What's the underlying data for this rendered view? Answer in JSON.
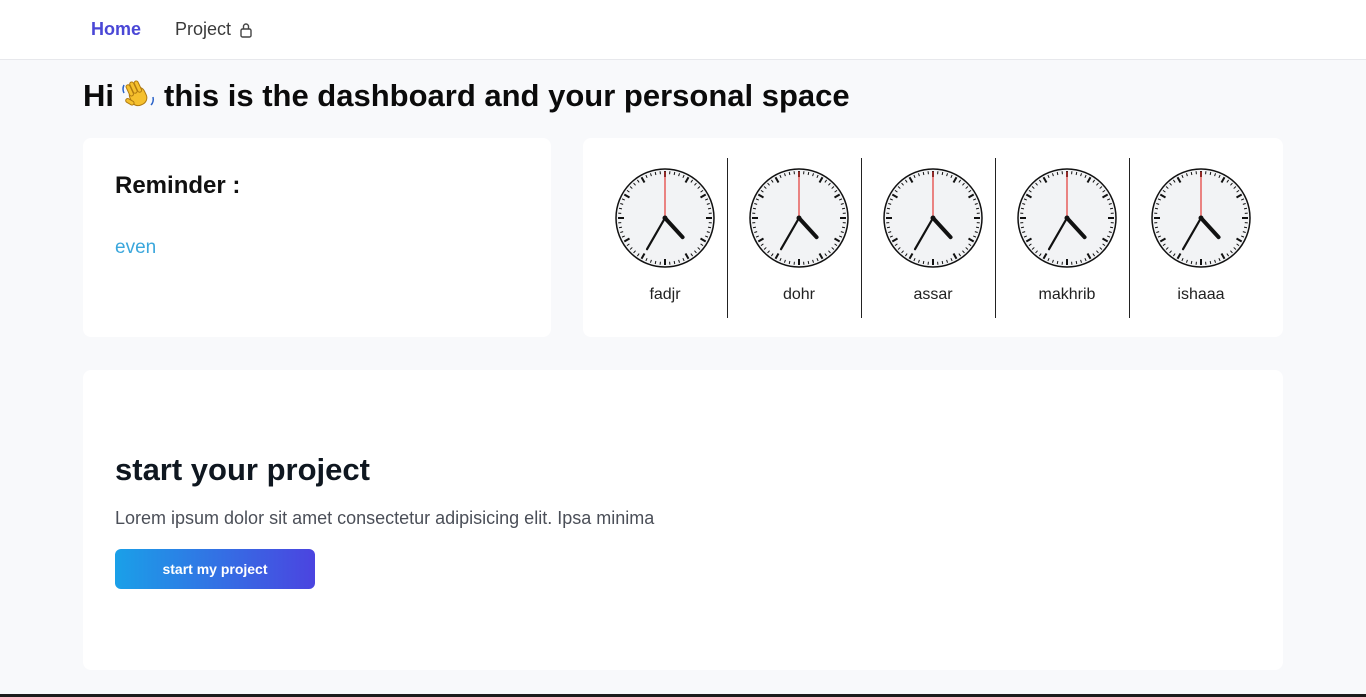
{
  "nav": {
    "home_label": "Home",
    "project_label": "Project",
    "project_icon": "lock-icon"
  },
  "greeting": {
    "prefix": "Hi",
    "emoji_icon": "waving-hand-icon",
    "text": "this is the dashboard and your personal space"
  },
  "reminder": {
    "title": "Reminder :",
    "text": "even"
  },
  "clocks": [
    {
      "label": "fadjr"
    },
    {
      "label": "dohr"
    },
    {
      "label": "assar"
    },
    {
      "label": "makhrib"
    },
    {
      "label": "ishaaa"
    }
  ],
  "clock_time": {
    "hour": 4,
    "minute": 35,
    "second": 0
  },
  "project": {
    "title": "start your project",
    "description": "Lorem ipsum dolor sit amet consectetur adipisicing elit. Ipsa minima",
    "button_label": "start my project"
  },
  "colors": {
    "accent": "#4a47d6",
    "reminder_text": "#3ba7dc",
    "button_start": "#1aa0e8",
    "button_end": "#4b44e0",
    "second_hand": "#e53935"
  }
}
